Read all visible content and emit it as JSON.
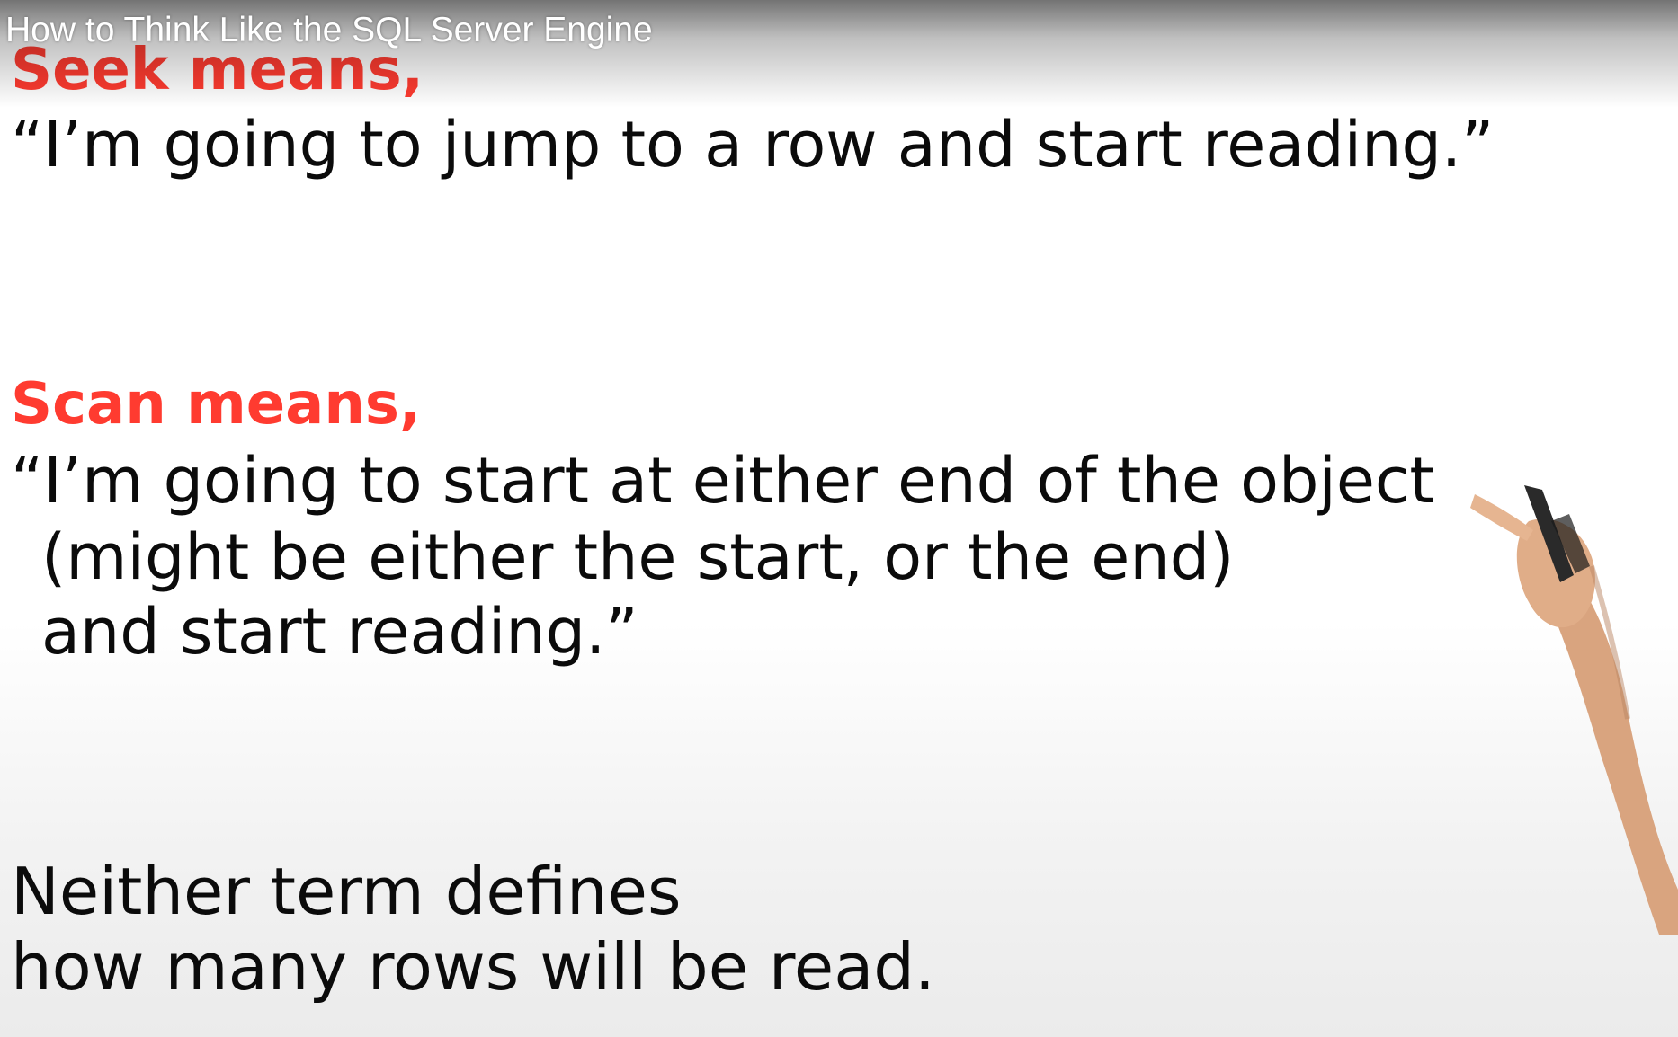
{
  "video": {
    "title": "How to Think Like the SQL Server Engine"
  },
  "slide": {
    "seek_heading": "Seek means,",
    "seek_quote": "“I’m going to jump to a row and start reading.”",
    "scan_heading": "Scan means,",
    "scan_quote_lines": [
      "“I’m going to start at either end of the object",
      "(might be either the start, or the end)",
      "and start reading.”"
    ],
    "conclusion_lines": [
      "Neither term defines",
      "how many rows will be read."
    ]
  },
  "colors": {
    "heading_red": "#ff3b30",
    "body_text": "#0b0b0b",
    "background": "#ffffff"
  }
}
